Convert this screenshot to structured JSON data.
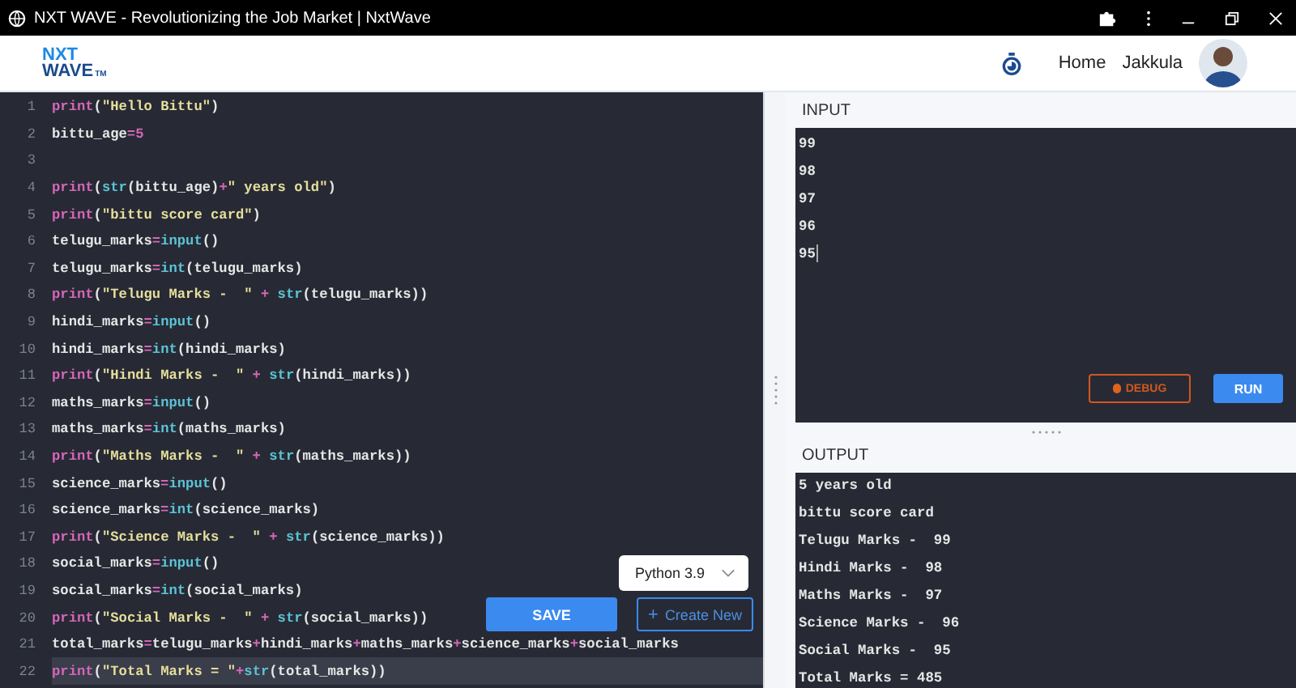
{
  "window": {
    "title": "NXT WAVE - Revolutionizing the Job Market | NxtWave"
  },
  "header": {
    "logo": {
      "line_1": "NXT",
      "line_2": "WAVE",
      "mark": "TM"
    },
    "nav": [
      {
        "label": "Home"
      }
    ],
    "user": {
      "name": "Jakkula"
    }
  },
  "editor": {
    "lines": [
      {
        "n": "1",
        "active": false,
        "tokens": [
          {
            "kind": "call",
            "text": "print"
          },
          {
            "kind": "plain",
            "text": "("
          },
          {
            "kind": "string",
            "text": "\"Hello Bittu\""
          },
          {
            "kind": "plain",
            "text": ")"
          }
        ]
      },
      {
        "n": "2",
        "active": false,
        "tokens": [
          {
            "kind": "plain",
            "text": "bittu_age"
          },
          {
            "kind": "op",
            "text": "=5"
          }
        ]
      },
      {
        "n": "3",
        "active": false
      },
      {
        "n": "4",
        "active": false,
        "tokens": [
          {
            "kind": "call",
            "text": "print"
          },
          {
            "kind": "plain",
            "text": "("
          },
          {
            "kind": "builtin",
            "text": "str"
          },
          {
            "kind": "plain",
            "text": "(bittu_age)"
          },
          {
            "kind": "op",
            "text": "+"
          },
          {
            "kind": "string",
            "text": "\" years old\""
          },
          {
            "kind": "plain",
            "text": ")"
          }
        ]
      },
      {
        "n": "5",
        "active": false,
        "tokens": [
          {
            "kind": "call",
            "text": "print"
          },
          {
            "kind": "plain",
            "text": "("
          },
          {
            "kind": "string",
            "text": "\"bittu score card\""
          },
          {
            "kind": "plain",
            "text": ")"
          }
        ]
      },
      {
        "n": "6",
        "active": false,
        "tokens": [
          {
            "kind": "plain",
            "text": "telugu_marks"
          },
          {
            "kind": "op",
            "text": "="
          },
          {
            "kind": "builtin",
            "text": "input"
          },
          {
            "kind": "plain",
            "text": "()"
          }
        ]
      },
      {
        "n": "7",
        "active": false,
        "tokens": [
          {
            "kind": "plain",
            "text": "telugu_marks"
          },
          {
            "kind": "op",
            "text": "="
          },
          {
            "kind": "builtin",
            "text": "int"
          },
          {
            "kind": "plain",
            "text": "(telugu_marks)"
          }
        ]
      },
      {
        "n": "8",
        "active": false,
        "tokens": [
          {
            "kind": "call",
            "text": "print"
          },
          {
            "kind": "plain",
            "text": "("
          },
          {
            "kind": "string",
            "text": "\"Telugu Marks -  \""
          },
          {
            "kind": "op",
            "text": " + "
          },
          {
            "kind": "builtin",
            "text": "str"
          },
          {
            "kind": "plain",
            "text": "(telugu_marks))"
          }
        ]
      },
      {
        "n": "9",
        "active": false,
        "tokens": [
          {
            "kind": "plain",
            "text": "hindi_marks"
          },
          {
            "kind": "op",
            "text": "="
          },
          {
            "kind": "builtin",
            "text": "input"
          },
          {
            "kind": "plain",
            "text": "()"
          }
        ]
      },
      {
        "n": "10",
        "active": false,
        "tokens": [
          {
            "kind": "plain",
            "text": "hindi_marks"
          },
          {
            "kind": "op",
            "text": "="
          },
          {
            "kind": "builtin",
            "text": "int"
          },
          {
            "kind": "plain",
            "text": "(hindi_marks)"
          }
        ]
      },
      {
        "n": "11",
        "active": false,
        "tokens": [
          {
            "kind": "call",
            "text": "print"
          },
          {
            "kind": "plain",
            "text": "("
          },
          {
            "kind": "string",
            "text": "\"Hindi Marks -  \""
          },
          {
            "kind": "op",
            "text": " + "
          },
          {
            "kind": "builtin",
            "text": "str"
          },
          {
            "kind": "plain",
            "text": "(hindi_marks))"
          }
        ]
      },
      {
        "n": "12",
        "active": false,
        "tokens": [
          {
            "kind": "plain",
            "text": "maths_marks"
          },
          {
            "kind": "op",
            "text": "="
          },
          {
            "kind": "builtin",
            "text": "input"
          },
          {
            "kind": "plain",
            "text": "()"
          }
        ]
      },
      {
        "n": "13",
        "active": false,
        "tokens": [
          {
            "kind": "plain",
            "text": "maths_marks"
          },
          {
            "kind": "op",
            "text": "="
          },
          {
            "kind": "builtin",
            "text": "int"
          },
          {
            "kind": "plain",
            "text": "(maths_marks)"
          }
        ]
      },
      {
        "n": "14",
        "active": false,
        "tokens": [
          {
            "kind": "call",
            "text": "print"
          },
          {
            "kind": "plain",
            "text": "("
          },
          {
            "kind": "string",
            "text": "\"Maths Marks -  \""
          },
          {
            "kind": "op",
            "text": " + "
          },
          {
            "kind": "builtin",
            "text": "str"
          },
          {
            "kind": "plain",
            "text": "(maths_marks))"
          }
        ]
      },
      {
        "n": "15",
        "active": false,
        "tokens": [
          {
            "kind": "plain",
            "text": "science_marks"
          },
          {
            "kind": "op",
            "text": "="
          },
          {
            "kind": "builtin",
            "text": "input"
          },
          {
            "kind": "plain",
            "text": "()"
          }
        ]
      },
      {
        "n": "16",
        "active": false,
        "tokens": [
          {
            "kind": "plain",
            "text": "science_marks"
          },
          {
            "kind": "op",
            "text": "="
          },
          {
            "kind": "builtin",
            "text": "int"
          },
          {
            "kind": "plain",
            "text": "(science_marks)"
          }
        ]
      },
      {
        "n": "17",
        "active": false,
        "tokens": [
          {
            "kind": "call",
            "text": "print"
          },
          {
            "kind": "plain",
            "text": "("
          },
          {
            "kind": "string",
            "text": "\"Science Marks -  \""
          },
          {
            "kind": "op",
            "text": " + "
          },
          {
            "kind": "builtin",
            "text": "str"
          },
          {
            "kind": "plain",
            "text": "(science_marks))"
          }
        ]
      },
      {
        "n": "18",
        "active": false,
        "tokens": [
          {
            "kind": "plain",
            "text": "social_marks"
          },
          {
            "kind": "op",
            "text": "="
          },
          {
            "kind": "builtin",
            "text": "input"
          },
          {
            "kind": "plain",
            "text": "()"
          }
        ]
      },
      {
        "n": "19",
        "active": false,
        "tokens": [
          {
            "kind": "plain",
            "text": "social_marks"
          },
          {
            "kind": "op",
            "text": "="
          },
          {
            "kind": "builtin",
            "text": "int"
          },
          {
            "kind": "plain",
            "text": "(social_marks)"
          }
        ]
      },
      {
        "n": "20",
        "active": false,
        "tokens": [
          {
            "kind": "call",
            "text": "print"
          },
          {
            "kind": "plain",
            "text": "("
          },
          {
            "kind": "string",
            "text": "\"Social Marks -  \""
          },
          {
            "kind": "op",
            "text": " + "
          },
          {
            "kind": "builtin",
            "text": "str"
          },
          {
            "kind": "plain",
            "text": "(social_marks))"
          }
        ]
      },
      {
        "n": "21",
        "active": false,
        "tokens": [
          {
            "kind": "plain",
            "text": "total_marks"
          },
          {
            "kind": "op",
            "text": "="
          },
          {
            "kind": "plain",
            "text": "telugu_marks"
          },
          {
            "kind": "op",
            "text": "+"
          },
          {
            "kind": "plain",
            "text": "hindi_marks"
          },
          {
            "kind": "op",
            "text": "+"
          },
          {
            "kind": "plain",
            "text": "maths_marks"
          },
          {
            "kind": "op",
            "text": "+"
          },
          {
            "kind": "plain",
            "text": "science_marks"
          },
          {
            "kind": "op",
            "text": "+"
          },
          {
            "kind": "plain",
            "text": "social_marks"
          }
        ]
      },
      {
        "n": "22",
        "active": true,
        "tokens": [
          {
            "kind": "call",
            "text": "print"
          },
          {
            "kind": "plain",
            "text": "("
          },
          {
            "kind": "string",
            "text": "\"Total Marks = \""
          },
          {
            "kind": "op",
            "text": "+"
          },
          {
            "kind": "builtin",
            "text": "str"
          },
          {
            "kind": "plain",
            "text": "(total_marks))"
          }
        ]
      }
    ]
  },
  "language": {
    "value": "Python 3.9"
  },
  "actions": [
    {
      "label": "SAVE",
      "kind": "primary"
    },
    {
      "label": "Create New",
      "kind": "outline",
      "icon": "+"
    }
  ],
  "input": {
    "label": "INPUT",
    "lines": [
      "99",
      "98",
      "97",
      "96",
      "95"
    ],
    "buttons": [
      {
        "label": "DEBUG",
        "kind": "debug"
      },
      {
        "label": "RUN",
        "kind": "run"
      }
    ]
  },
  "output": {
    "label": "OUTPUT",
    "lines": [
      "5 years old",
      "bittu score card",
      "Telugu Marks -  99",
      "Hindi Marks -  98",
      "Maths Marks -  97",
      "Science Marks -  96",
      "Social Marks -  95",
      "Total Marks = 485"
    ]
  }
}
